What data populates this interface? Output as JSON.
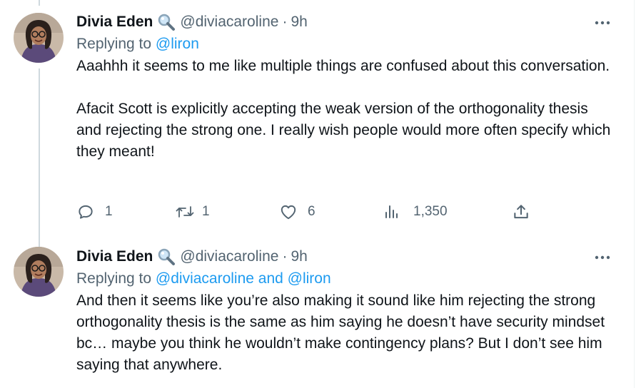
{
  "tweets": [
    {
      "author_name": "Divia Eden",
      "handle": "@diviacaroline",
      "separator": "·",
      "time": "9h",
      "replying_prefix": "Replying to ",
      "replying_to": "@liron",
      "paragraphs": [
        "Aaahhh it seems to me like multiple things are confused about this conversation.",
        "Afacit Scott is explicitly accepting the weak version of the orthogonality thesis and rejecting the strong one. I really wish people would more often specify which they meant!"
      ],
      "stats": {
        "replies": "1",
        "reposts": "1",
        "likes": "6",
        "views": "1,350"
      }
    },
    {
      "author_name": "Divia Eden",
      "handle": "@diviacaroline",
      "separator": "·",
      "time": "9h",
      "replying_prefix": "Replying to ",
      "replying_to": "@diviacaroline and @liron",
      "paragraphs": [
        "And then it seems like you’re also making it sound like him rejecting the strong orthogonality thesis is the same as him saying he doesn’t have security mindset bc… maybe you think he wouldn’t make contingency plans? But I don’t see him saying that anywhere."
      ]
    }
  ],
  "icons": {
    "verified": "magnifying-glass-emoji-icon",
    "more": "more-dots-icon",
    "reply": "reply-bubble-icon",
    "repost": "repost-arrows-icon",
    "like": "heart-icon",
    "views": "bar-chart-icon",
    "share": "share-upload-icon"
  },
  "colors": {
    "link": "#1d9bf0",
    "secondary_text": "#536471",
    "primary_text": "#0f1419",
    "thread_line": "#cfd9de"
  }
}
